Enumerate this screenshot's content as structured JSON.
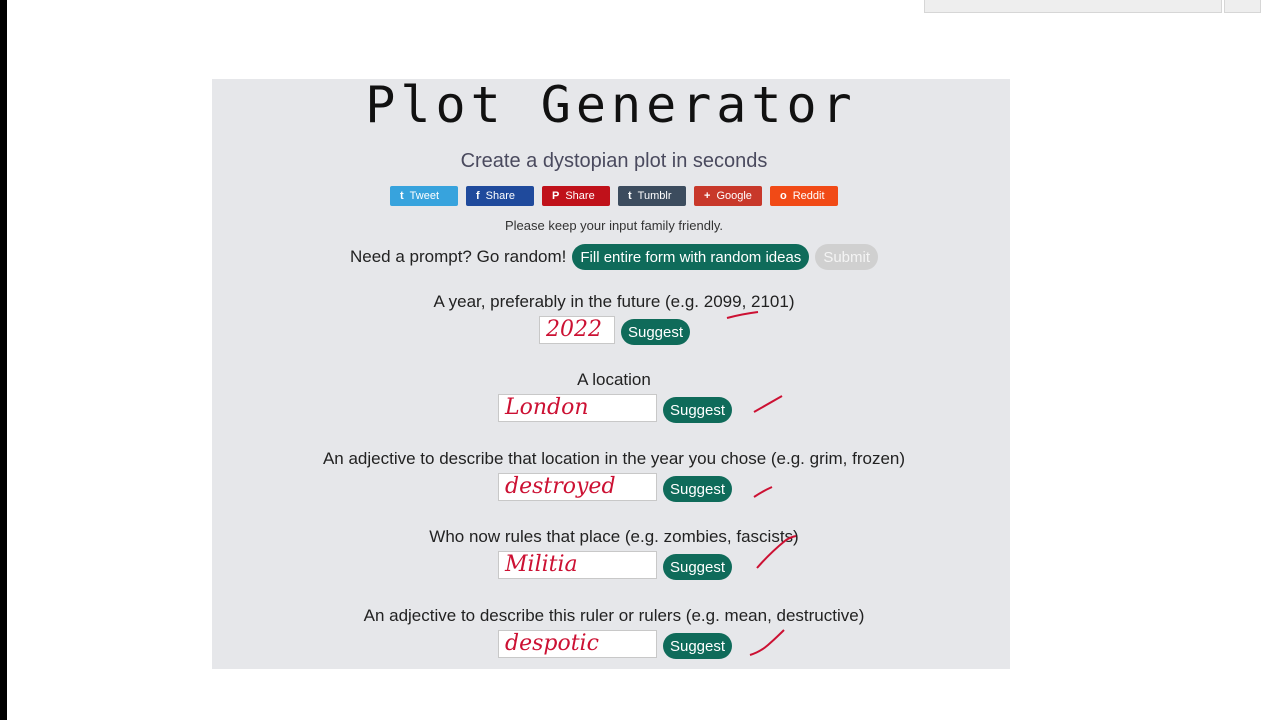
{
  "page": {
    "title": "Plot Generator",
    "subtitle": "Create a dystopian plot in seconds",
    "note": "Please keep your input family friendly."
  },
  "share": [
    {
      "label": "Tweet",
      "icon": "twitter-icon",
      "glyph": "t",
      "color": "#37a3dd"
    },
    {
      "label": "Share",
      "icon": "facebook-icon",
      "glyph": "f",
      "color": "#1f4a9c"
    },
    {
      "label": "Share",
      "icon": "pinterest-icon",
      "glyph": "P",
      "color": "#c0111a"
    },
    {
      "label": "Tumblr",
      "icon": "tumblr-icon",
      "glyph": "t",
      "color": "#3c4c5e"
    },
    {
      "label": "Google",
      "icon": "google-plus-icon",
      "glyph": "+",
      "color": "#c8382a"
    },
    {
      "label": "Reddit",
      "icon": "reddit-icon",
      "glyph": "o",
      "color": "#f14a16"
    }
  ],
  "prompt": {
    "text": "Need a prompt? Go random!",
    "fill_label": "Fill entire form with random ideas",
    "submit_label": "Submit"
  },
  "fields": [
    {
      "label": "A year, preferably in the future (e.g. 2099, 2101)",
      "value": "2022",
      "suggest": "Suggest"
    },
    {
      "label": "A location",
      "value": "London",
      "suggest": "Suggest"
    },
    {
      "label": "An adjective to describe that location in the year you chose (e.g. grim, frozen)",
      "value": "destroyed",
      "suggest": "Suggest"
    },
    {
      "label": "Who now rules that place (e.g. zombies, fascists)",
      "value": "Militia",
      "suggest": "Suggest"
    },
    {
      "label": "An adjective to describe this ruler or rulers (e.g. mean, destructive)",
      "value": "despotic",
      "suggest": "Suggest"
    }
  ],
  "colors": {
    "panel": "#e6e7ea",
    "accent_green": "#0f6b5a",
    "ink": "#cc1133"
  }
}
